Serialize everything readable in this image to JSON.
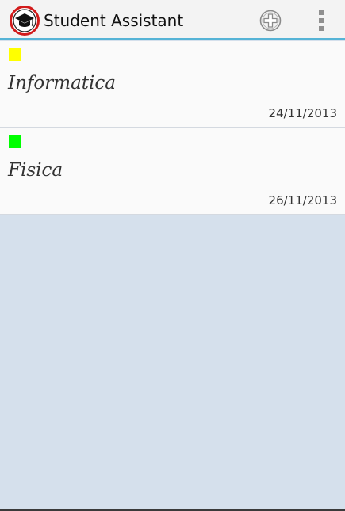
{
  "action_bar": {
    "title": "Student Assistant",
    "app_icon": "graduation-cap-icon",
    "add_icon": "add-circle-icon",
    "overflow_icon": "more-vert-icon",
    "accent_color": "#55b3d6"
  },
  "subjects": [
    {
      "name": "Informatica",
      "date": "24/11/2013",
      "color": "#ffff00"
    },
    {
      "name": "Fisica",
      "date": "26/11/2013",
      "color": "#00ff00"
    }
  ],
  "colors": {
    "list_background": "#d5e0ec",
    "item_background": "#fafafa"
  }
}
